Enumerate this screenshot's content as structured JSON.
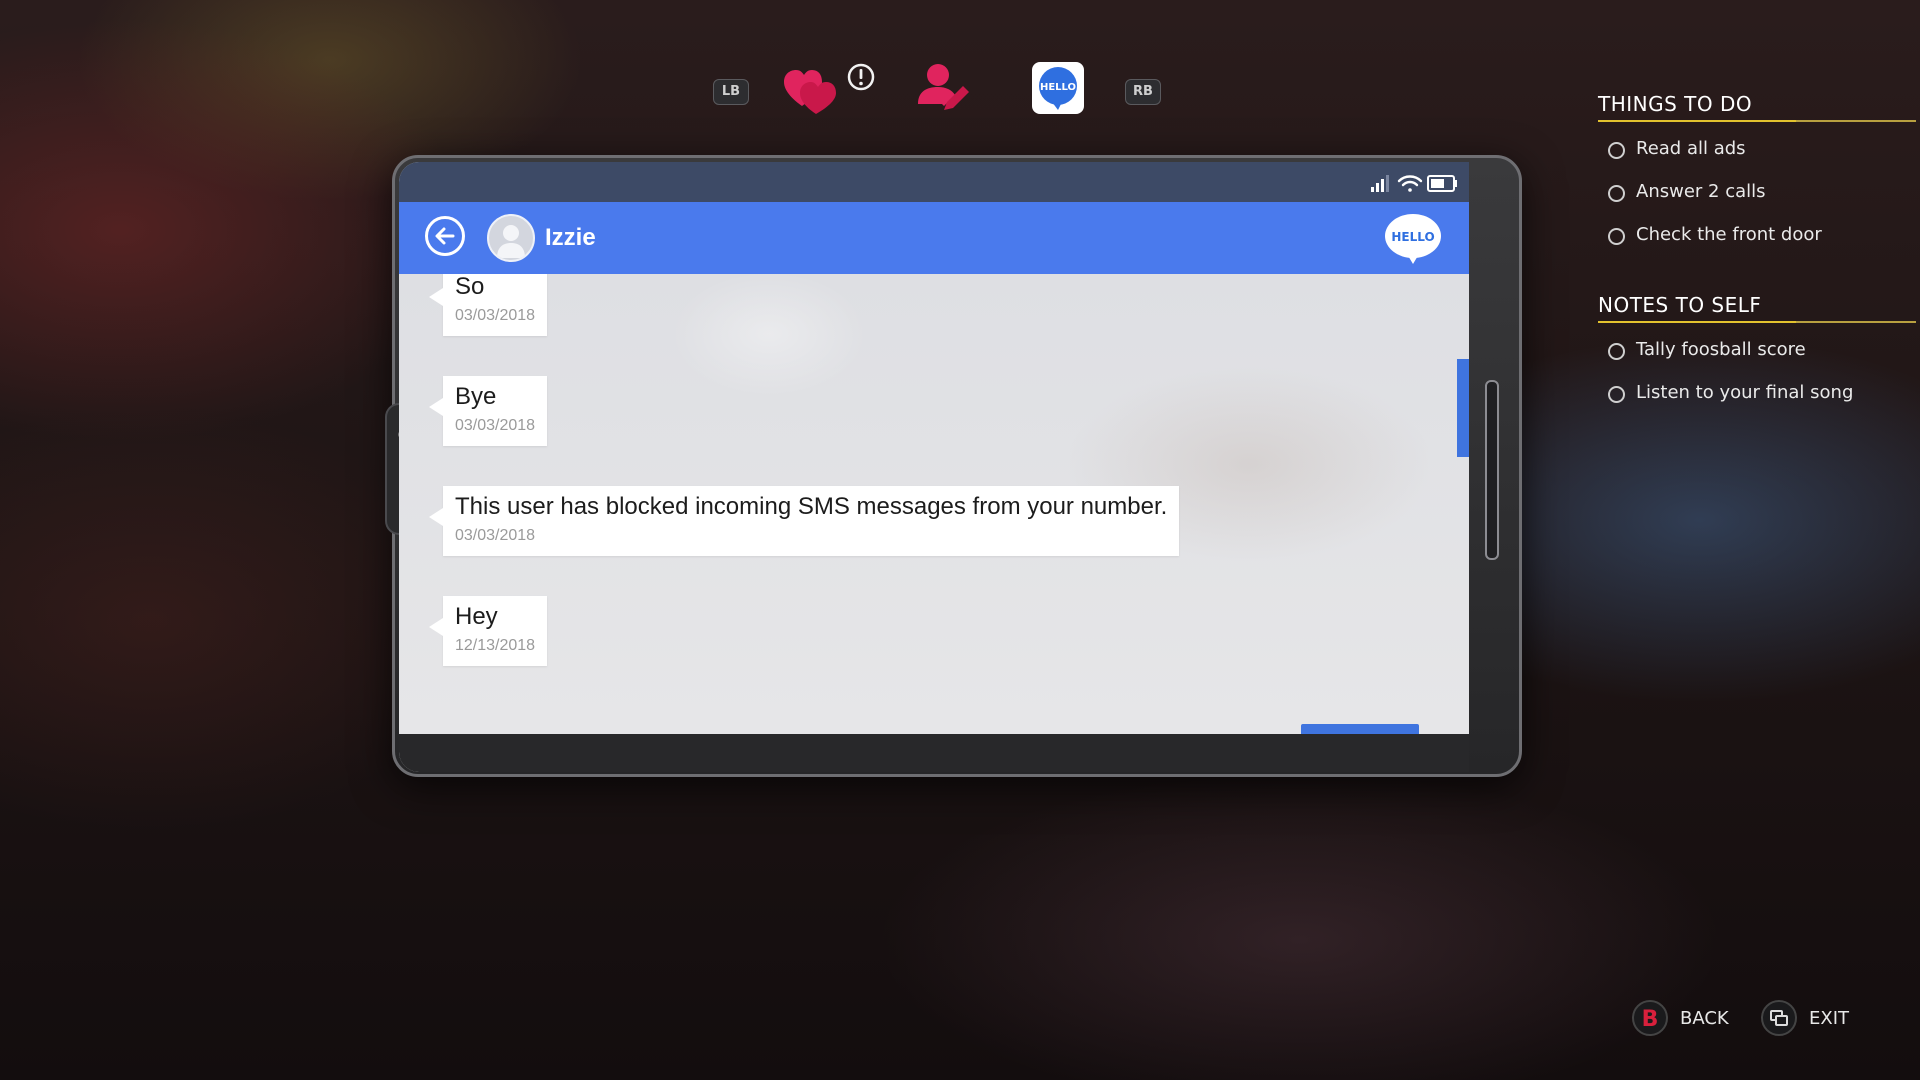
{
  "tabs": {
    "left_bumper": "LB",
    "right_bumper": "RB",
    "items": [
      {
        "icon": "hearts-icon",
        "alert": true
      },
      {
        "icon": "profile-edit-icon"
      },
      {
        "icon": "hello-messenger-icon",
        "active": true
      }
    ]
  },
  "phone": {
    "status_icons": [
      "signal-icon",
      "wifi-icon",
      "battery-icon"
    ],
    "contact_name": "Izzie",
    "app_badge": "HELLO",
    "messages": [
      {
        "text": "So",
        "date": "03/03/2018"
      },
      {
        "text": "Bye",
        "date": "03/03/2018"
      },
      {
        "text": "This user has blocked incoming SMS messages from your number.",
        "date": "03/03/2018"
      },
      {
        "text": "Hey",
        "date": "12/13/2018"
      }
    ]
  },
  "things_to_do": {
    "title": "THINGS TO DO",
    "items": [
      "Read all ads",
      "Answer 2 calls",
      "Check the front door"
    ]
  },
  "notes_to_self": {
    "title": "NOTES TO SELF",
    "items": [
      "Tally foosball score",
      "Listen to your final song"
    ]
  },
  "hints": {
    "back": {
      "button": "B",
      "label": "BACK"
    },
    "exit": {
      "label": "EXIT"
    }
  },
  "colors": {
    "accent_blue": "#4a7aed",
    "heart_pink": "#e0245e",
    "task_underline": "#e2c22e",
    "back_button_red": "#d8203c"
  }
}
